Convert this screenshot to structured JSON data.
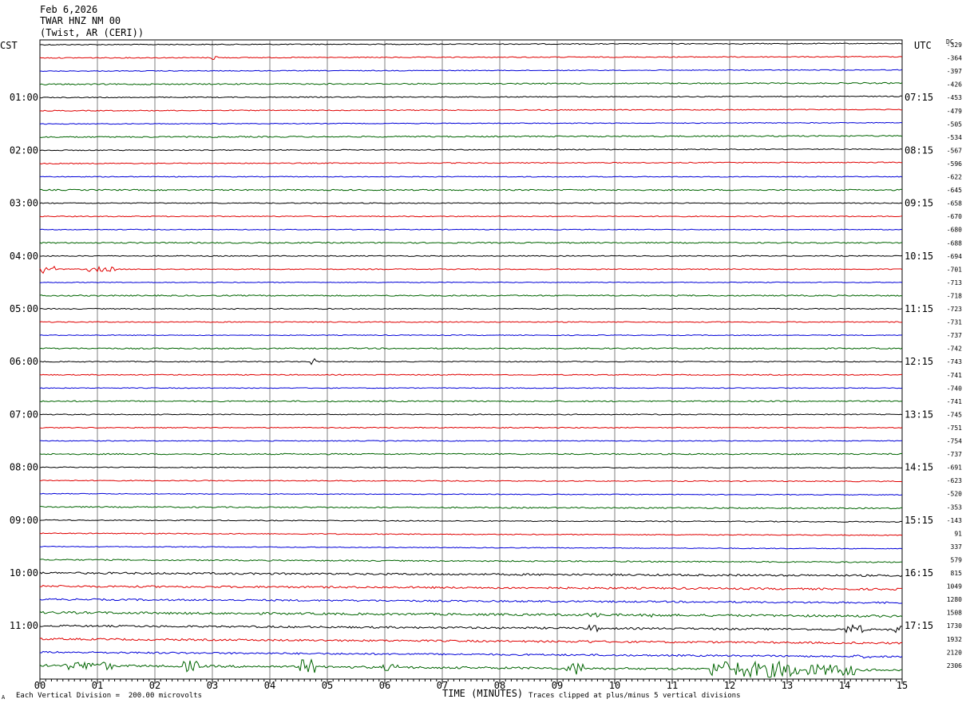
{
  "header": {
    "date": "Feb 6,2026",
    "station": "TWAR HNZ NM 00",
    "location": "(Twist, AR (CERI))"
  },
  "left_tz": "CST",
  "right_tz": "UTC",
  "dc_label": "DC",
  "footer": {
    "scale": "Each Vertical Division =  200.00 microvolts",
    "clip": "Traces clipped at plus/minus 5 vertical divisions",
    "corner_mark": "A"
  },
  "colors": {
    "trace": [
      "#000000",
      "#e00000",
      "#0000d8",
      "#006400"
    ],
    "grid": "#808080"
  },
  "chart_data": {
    "type": "line",
    "title": "TWAR HNZ NM 00",
    "xlabel": "TIME (MINUTES)",
    "xlim": [
      0,
      15
    ],
    "x_ticks": [
      "00",
      "01",
      "02",
      "03",
      "04",
      "05",
      "06",
      "07",
      "08",
      "09",
      "10",
      "11",
      "12",
      "13",
      "14",
      "15"
    ],
    "left_hour_labels": [
      "01:00",
      "02:00",
      "03:00",
      "04:00",
      "05:00",
      "06:00",
      "07:00",
      "08:00",
      "09:00",
      "10:00",
      "11:00"
    ],
    "right_hour_labels": [
      "07:15",
      "08:15",
      "09:15",
      "10:15",
      "11:15",
      "12:15",
      "13:15",
      "14:15",
      "15:15",
      "16:15",
      "17:15"
    ],
    "dc_offsets": [
      -329,
      -364,
      -397,
      -426,
      -453,
      -479,
      -505,
      -534,
      -567,
      -596,
      -622,
      -645,
      -658,
      -670,
      -680,
      -688,
      -694,
      -701,
      -713,
      -718,
      -723,
      -731,
      -737,
      -742,
      -743,
      -741,
      -740,
      -741,
      -745,
      -751,
      -754,
      -737,
      -691,
      -623,
      -520,
      -353,
      -143,
      91,
      337,
      579,
      815,
      1049,
      1280,
      1508,
      1730,
      1932,
      2120,
      2306
    ],
    "trace_count": 48,
    "minutes_per_trace": 15,
    "series_colors": [
      "black",
      "red",
      "blue",
      "green"
    ]
  }
}
